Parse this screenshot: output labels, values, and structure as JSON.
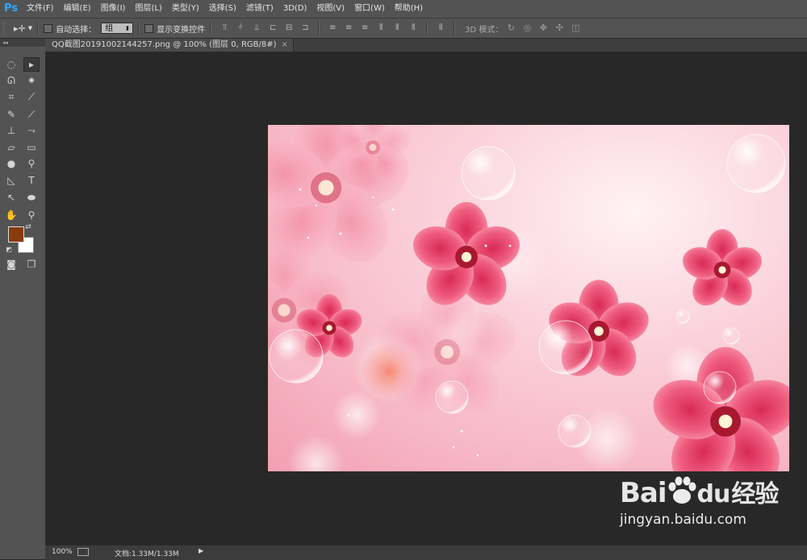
{
  "app": {
    "logo": "Ps"
  },
  "menu": [
    "文件(F)",
    "编辑(E)",
    "图像(I)",
    "图层(L)",
    "类型(Y)",
    "选择(S)",
    "滤镜(T)",
    "3D(D)",
    "视图(V)",
    "窗口(W)",
    "帮助(H)"
  ],
  "options": {
    "auto_select_label": "自动选择：",
    "auto_select_value": "组",
    "show_transform_label": "显示变换控件",
    "mode_3d_label": "3D 模式："
  },
  "document": {
    "tab_title": "QQ截图20191002144257.png @ 100% (图层 0, RGB/8#)",
    "tab_close": "×"
  },
  "toolbox": {
    "collapse_label": "◂◂"
  },
  "status": {
    "zoom": "100%",
    "doc_info": "文档:1.33M/1.33M"
  },
  "colors": {
    "foreground": "#8a3b0c",
    "background": "#ffffff",
    "panel": "#535353",
    "workspace": "#282828"
  },
  "watermark": {
    "brand": "Bai",
    "brand_icon": "paw-icon",
    "brand2": "du",
    "cn": "经验",
    "url": "jingyan.baidu.com"
  }
}
